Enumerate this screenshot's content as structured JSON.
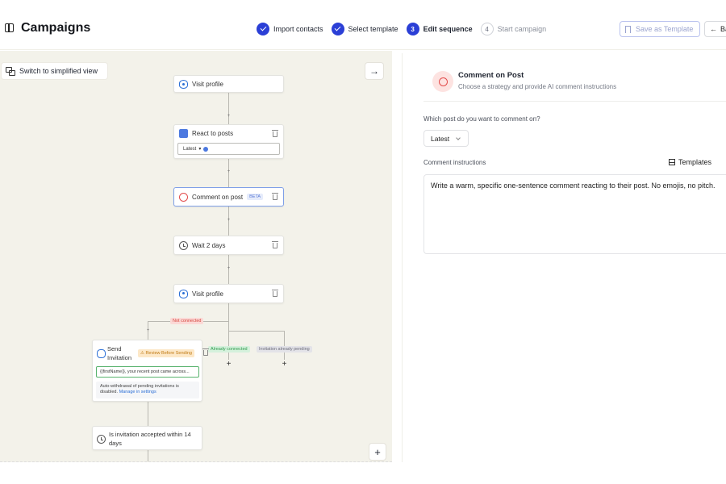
{
  "header": {
    "title": "Campaigns",
    "steps": [
      {
        "label": "Import contacts",
        "state": "done"
      },
      {
        "label": "Select template",
        "state": "done"
      },
      {
        "number": "3",
        "label": "Edit sequence",
        "state": "active"
      },
      {
        "number": "4",
        "label": "Start campaign",
        "state": "todo"
      }
    ],
    "save_template_label": "Save as Template",
    "back_label": "Ba"
  },
  "canvas": {
    "simplified_view_label": "Switch to simplified view",
    "nodes": {
      "visit_profile_1": "Visit profile",
      "react_to_posts": "React to posts",
      "react_select_value": "Latest",
      "comment_on_post": "Comment on post",
      "comment_badge": "BETA",
      "wait": "Wait 2 days",
      "visit_profile_2": "Visit profile",
      "send_invitation": "Send Invitation",
      "review_badge": "⚠ Review Before Sending",
      "invitation_message": "{{firstName}}, your recent post came across...",
      "auto_withdraw_note": "Auto-withdrawal of pending invitations is disabled.",
      "manage_settings_link": "Manage in settings",
      "invitation_accepted": "Is invitation accepted within 14 days"
    },
    "branch_tags": {
      "not_connected": "Not connected",
      "already_connected": "Already connected",
      "invitation_pending": "Invitation already pending"
    }
  },
  "panel": {
    "title": "Comment on Post",
    "subtitle": "Choose a strategy and provide AI comment instructions",
    "post_question": "Which post do you want to comment on?",
    "post_selected": "Latest",
    "instructions_label": "Comment instructions",
    "templates_label": "Templates",
    "instructions_value": "Write a warm, specific one-sentence comment reacting to their post. No emojis, no pitch."
  },
  "colors": {
    "accent": "#2b3fd6",
    "canvas_bg": "#f3f2ea",
    "comment_accent": "#e24c4c",
    "connected_green": "#2f9a4c"
  }
}
